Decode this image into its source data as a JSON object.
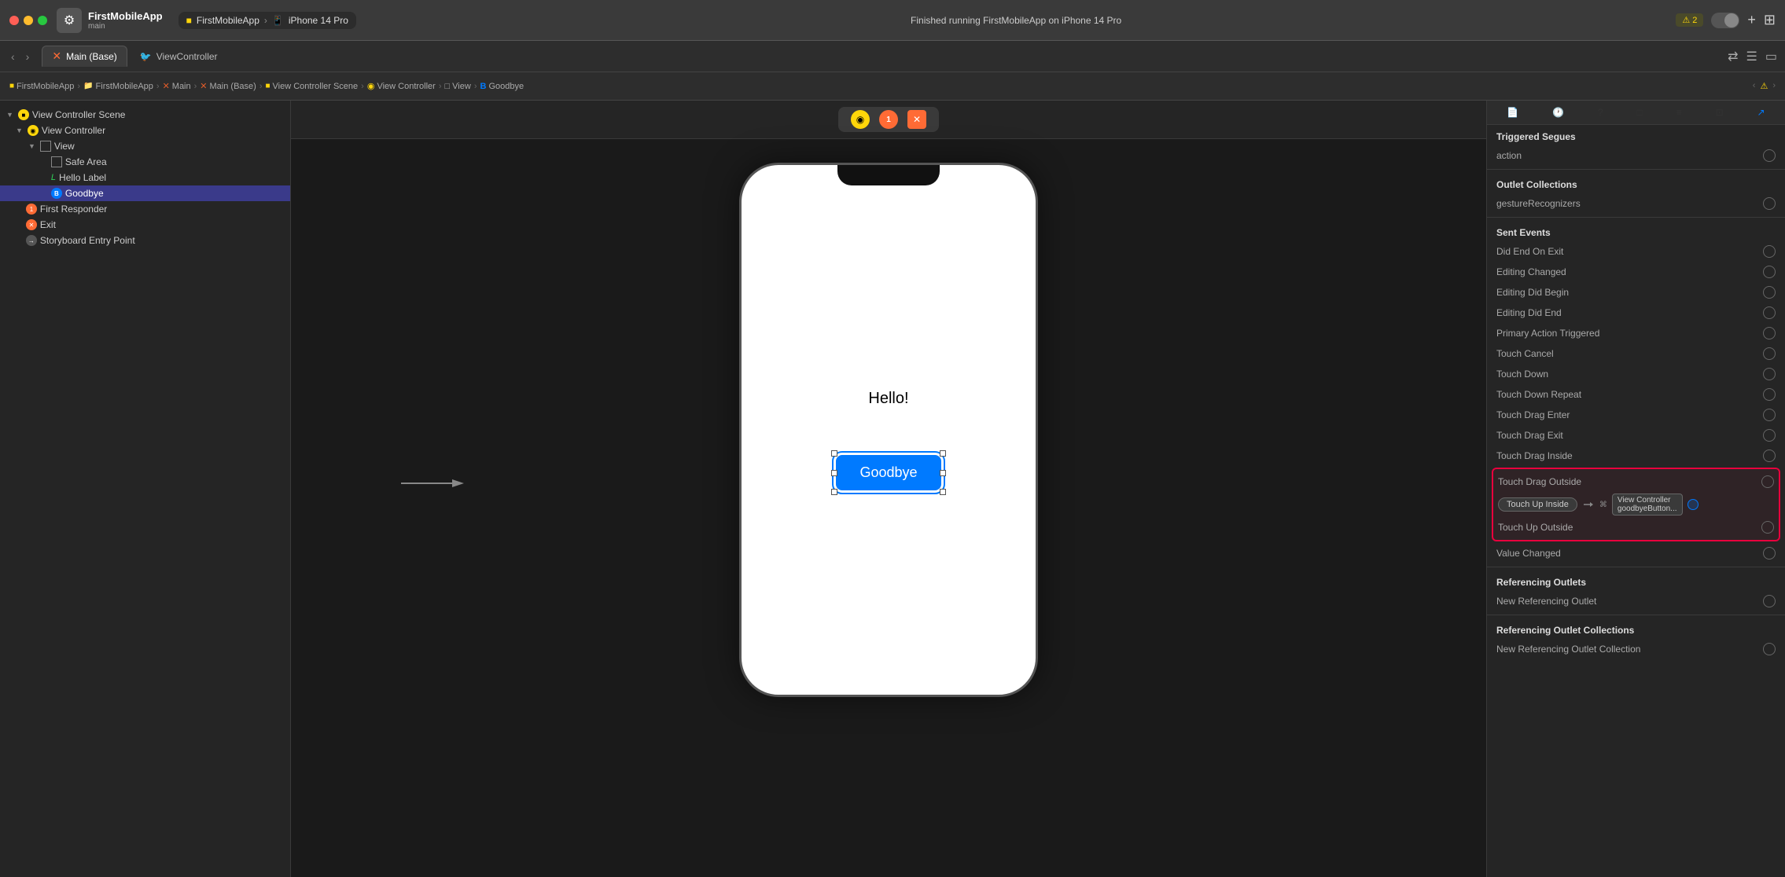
{
  "titleBar": {
    "appName": "FirstMobileApp",
    "appSub": "main",
    "breadcrumb1": "FirstMobileApp",
    "breadcrumb2": "FirstMobileApp",
    "breadcrumb3": "Main",
    "breadcrumb4": "Main (Base)",
    "breadcrumb5": "View Controller Scene",
    "breadcrumb6": "View Controller",
    "breadcrumb7": "View",
    "breadcrumb8": "Goodbye",
    "runningText": "Finished running FirstMobileApp on iPhone 14 Pro",
    "warningCount": "⚠ 2",
    "device": "iPhone 14 Pro"
  },
  "tabs": {
    "tab1": "Main (Base)",
    "tab2": "ViewController"
  },
  "sidebar": {
    "sceneLabel": "View Controller Scene",
    "vcLabel": "View Controller",
    "viewLabel": "View",
    "safeAreaLabel": "Safe Area",
    "helloLabelLabel": "Hello Label",
    "goodbyeLabel": "Goodbye",
    "firstResponderLabel": "First Responder",
    "exitLabel": "Exit",
    "storyboardEntryLabel": "Storyboard Entry Point"
  },
  "rightPanel": {
    "triggeredSegues": "Triggered Segues",
    "action": "action",
    "outletCollections": "Outlet Collections",
    "gestureRecognizers": "gestureRecognizers",
    "sentEvents": "Sent Events",
    "didEndOnExit": "Did End On Exit",
    "editingChanged": "Editing Changed",
    "editingDidBegin": "Editing Did Begin",
    "editingDidEnd": "Editing Did End",
    "primaryActionTriggered": "Primary Action Triggered",
    "touchCancel": "Touch Cancel",
    "touchDown": "Touch Down",
    "touchDownRepeat": "Touch Down Repeat",
    "touchDragEnter": "Touch Drag Enter",
    "touchDragExit": "Touch Drag Exit",
    "touchDragInside": "Touch Drag Inside",
    "touchDragOutside": "Touch Drag Outside",
    "touchUpInside": "Touch Up Inside",
    "touchUpOutside": "Touch Up Outside",
    "valueChanged": "Value Changed",
    "referencingOutlets": "Referencing Outlets",
    "newReferencingOutlet": "New Referencing Outlet",
    "referencingOutletCollections": "Referencing Outlet Collections",
    "newReferencingOutletCollection": "New Referencing Outlet Collection",
    "connectionVC": "View Controller",
    "connectionMethod": "goodbyeButton...",
    "cmdSymbol": "⌘"
  },
  "canvas": {
    "helloText": "Hello!",
    "goodbyeText": "Goodbye"
  }
}
